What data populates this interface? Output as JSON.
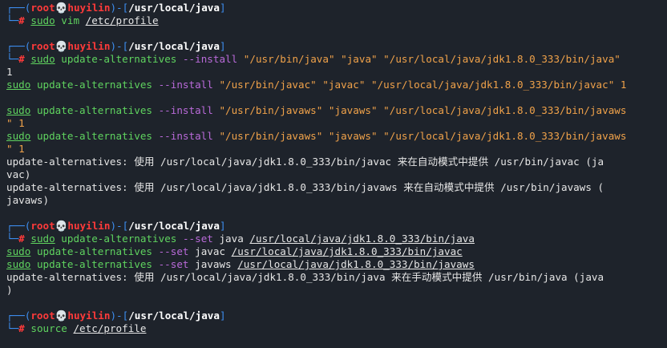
{
  "prompts": [
    {
      "user": "root",
      "host": "huyilin",
      "cwd": "/usr/local/java",
      "cmd": "sudo",
      "rest": "vim",
      "file": "/etc/profile"
    },
    {
      "user": "root",
      "host": "huyilin",
      "cwd": "/usr/local/java",
      "cmd": "sudo",
      "rest": "update-alternatives",
      "opt": "--install",
      "args": "\"/usr/bin/java\" \"java\" \"/usr/local/java/jdk1.8.0_333/bin/java\""
    },
    {
      "user": "root",
      "host": "huyilin",
      "cwd": "/usr/local/java",
      "cmd": "sudo",
      "rest": "update-alternatives",
      "opt": "--set",
      "name": "java",
      "file": "/usr/local/java/jdk1.8.0_333/bin/java"
    },
    {
      "user": "root",
      "host": "huyilin",
      "cwd": "/usr/local/java",
      "cmd": "source",
      "file": "/etc/profile"
    }
  ],
  "output": {
    "o1": "1",
    "javac_install_cmd": "sudo",
    "javac_install_tool": "update-alternatives",
    "javac_install_opt": "--install",
    "javac_install_args": "\"/usr/bin/javac\" \"javac\" \"/usr/local/java/jdk1.8.0_333/bin/javac\" 1",
    "javaws1_cmd": "sudo",
    "javaws1_tool": "update-alternatives",
    "javaws1_opt": "--install",
    "javaws1_args": "\"/usr/bin/javaws\" \"javaws\" \"/usr/local/java/jdk1.8.0_333/bin/javaws",
    "javaws1_wrap": "\" 1",
    "javaws2_cmd": "sudo",
    "javaws2_tool": "update-alternatives",
    "javaws2_opt": "--install",
    "javaws2_args": "\"/usr/bin/javaws\" \"javaws\" \"/usr/local/java/jdk1.8.0_333/bin/javaws",
    "javaws2_wrap": "\" 1",
    "ua_javac_1": "update-alternatives: 使用 /usr/local/java/jdk1.8.0_333/bin/javac 来在自动模式中提供 /usr/bin/javac (ja",
    "ua_javac_2": "vac)",
    "ua_javaws_1": "update-alternatives: 使用 /usr/local/java/jdk1.8.0_333/bin/javaws 来在自动模式中提供 /usr/bin/javaws (",
    "ua_javaws_2": "javaws)",
    "set_javac_cmd": "sudo",
    "set_javac_tool": "update-alternatives",
    "set_javac_opt": "--set",
    "set_javac_name": "javac",
    "set_javac_file": "/usr/local/java/jdk1.8.0_333/bin/javac",
    "set_javaws_cmd": "sudo",
    "set_javaws_tool": "update-alternatives",
    "set_javaws_opt": "--set",
    "set_javaws_name": "javaws",
    "set_javaws_file": "/usr/local/java/jdk1.8.0_333/bin/javaws",
    "ua_java_1": "update-alternatives: 使用 /usr/local/java/jdk1.8.0_333/bin/java 来在手动模式中提供 /usr/bin/java (java",
    "ua_java_2": ")"
  },
  "glyphs": {
    "corner_top": "┌──(",
    "close_paren": ")-[",
    "close_bracket": "]",
    "corner_bottom": "└─",
    "hash": "#",
    "skull": "💀"
  },
  "colors": {
    "background": "#1e232b",
    "prompt_frame": "#3d8ef0",
    "user": "#ff3a3a",
    "command": "#5fd35f",
    "option": "#b96ad9",
    "string": "#f0a24a"
  }
}
